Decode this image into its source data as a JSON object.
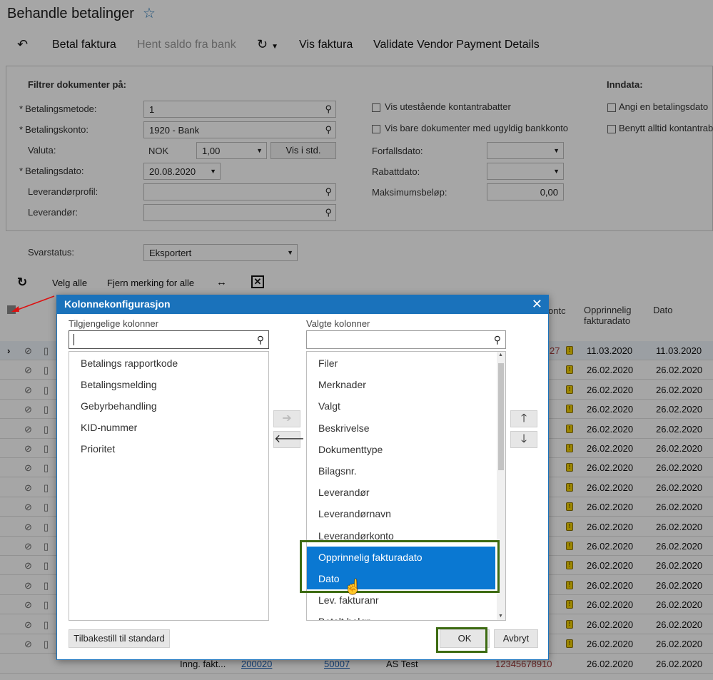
{
  "page": {
    "title": "Behandle betalinger"
  },
  "toolbar": {
    "pay_invoice": "Betal faktura",
    "fetch_balance": "Hent saldo fra bank",
    "view_invoice": "Vis faktura",
    "validate": "Validate Vendor Payment Details"
  },
  "filter": {
    "heading": "Filtrer dokumenter på:",
    "input_heading": "Inndata:",
    "required_mark": "*",
    "payment_method_label": "Betalingsmetode:",
    "payment_method_value": "1",
    "payment_account_label": "Betalingskonto:",
    "payment_account_value": "1920 - Bank",
    "currency_label": "Valuta:",
    "currency_value": "NOK",
    "rate_value": "1,00",
    "show_std_label": "Vis i std.",
    "payment_date_label": "Betalingsdato:",
    "payment_date_value": "20.08.2020",
    "vendor_profile_label": "Leverandørprofil:",
    "vendor_label": "Leverandør:",
    "show_outstanding_discounts": "Vis utestående kontantrabatter",
    "show_invalid_bank": "Vis bare dokumenter med ugyldig bankkonto",
    "due_date_label": "Forfallsdato:",
    "discount_date_label": "Rabattdato:",
    "max_amount_label": "Maksimumsbeløp:",
    "max_amount_value": "0,00",
    "set_payment_date": "Angi en betalingsdato",
    "always_use_discount": "Benytt alltid kontantrab",
    "response_status_label": "Svarstatus:",
    "response_status_value": "Eksportert"
  },
  "grid_toolbar": {
    "select_all": "Velg alle",
    "unselect_all": "Fjern merking for alle"
  },
  "grid": {
    "col_partial": "ontc",
    "col_orig_date": "Opprinnelig fakturadato",
    "col_date": "Dato",
    "partial_first": "27",
    "rows": [
      {
        "orig": "11.03.2020",
        "date": "11.03.2020"
      },
      {
        "orig": "26.02.2020",
        "date": "26.02.2020"
      },
      {
        "orig": "26.02.2020",
        "date": "26.02.2020"
      },
      {
        "orig": "26.02.2020",
        "date": "26.02.2020"
      },
      {
        "orig": "26.02.2020",
        "date": "26.02.2020"
      },
      {
        "orig": "26.02.2020",
        "date": "26.02.2020"
      },
      {
        "orig": "26.02.2020",
        "date": "26.02.2020"
      },
      {
        "orig": "26.02.2020",
        "date": "26.02.2020"
      },
      {
        "orig": "26.02.2020",
        "date": "26.02.2020"
      },
      {
        "orig": "26.02.2020",
        "date": "26.02.2020"
      },
      {
        "orig": "26.02.2020",
        "date": "26.02.2020"
      },
      {
        "orig": "26.02.2020",
        "date": "26.02.2020"
      },
      {
        "orig": "26.02.2020",
        "date": "26.02.2020"
      },
      {
        "orig": "26.02.2020",
        "date": "26.02.2020"
      },
      {
        "orig": "26.02.2020",
        "date": "26.02.2020"
      },
      {
        "orig": "26.02.2020",
        "date": "26.02.2020"
      }
    ],
    "last_row": {
      "type": "Inng. fakt...",
      "ref": "200020",
      "vendor": "50007",
      "name": "AS Test",
      "account": "12345678910",
      "orig": "26.02.2020",
      "date": "26.02.2020"
    }
  },
  "dialog": {
    "title": "Kolonnekonfigurasjon",
    "available_label": "Tilgjengelige kolonner",
    "selected_label": "Valgte kolonner",
    "available": [
      "Betalings rapportkode",
      "Betalingsmelding",
      "Gebyrbehandling",
      "KID-nummer",
      "Prioritet"
    ],
    "selected": [
      "Filer",
      "Merknader",
      "Valgt",
      "Beskrivelse",
      "Dokumenttype",
      "Bilagsnr.",
      "Leverandør",
      "Leverandørnavn",
      "Leverandørkonto",
      "Opprinnelig fakturadato",
      "Dato",
      "Lev. fakturanr",
      "Betalt beløp"
    ],
    "reset_label": "Tilbakestill til standard",
    "ok_label": "OK",
    "cancel_label": "Avbryt"
  },
  "colors": {
    "accent": "#1a72bb",
    "selection": "#0a78d2",
    "highlight": "#3d6b12",
    "warning": "#f2d000"
  }
}
